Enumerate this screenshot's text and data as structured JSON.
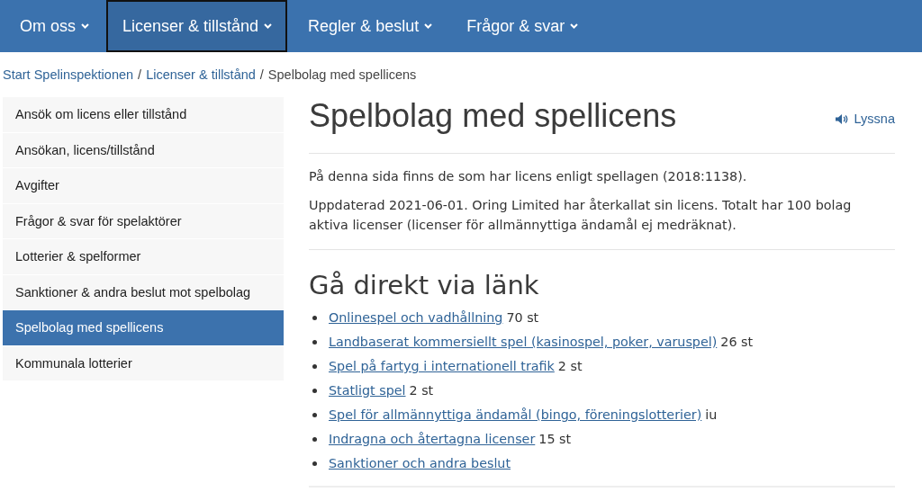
{
  "nav": [
    {
      "label": "Om oss",
      "selected": false
    },
    {
      "label": "Licenser & tillstånd",
      "selected": true
    },
    {
      "label": "Regler & beslut",
      "selected": false
    },
    {
      "label": "Frågor & svar",
      "selected": false
    }
  ],
  "breadcrumb": {
    "separator": "/",
    "links": [
      "Start Spelinspektionen",
      "Licenser & tillstånd"
    ],
    "current": "Spelbolag med spellicens"
  },
  "sidebar": {
    "items": [
      {
        "label": "Ansök om licens eller tillstånd",
        "selected": false
      },
      {
        "label": "Ansökan, licens/tillstånd",
        "selected": false
      },
      {
        "label": "Avgifter",
        "selected": false
      },
      {
        "label": "Frågor & svar för spelaktörer",
        "selected": false
      },
      {
        "label": "Lotterier & spelformer",
        "selected": false
      },
      {
        "label": "Sanktioner & andra beslut mot spelbolag",
        "selected": false
      },
      {
        "label": "Spelbolag med spellicens",
        "selected": true
      },
      {
        "label": "Kommunala lotterier",
        "selected": false
      }
    ]
  },
  "page": {
    "title": "Spelbolag med spellicens",
    "listen": "Lyssna",
    "paragraphs": [
      "På denna sida finns de som har licens enligt spellagen (2018:1138).",
      "Uppdaterad 2021-06-01. Oring Limited har återkallat sin licens. Totalt har 100 bolag aktiva licenser (licenser för allmännyttiga ändamål ej medräknat)."
    ],
    "links_heading": "Gå direkt via länk",
    "links": [
      {
        "label": "Onlinespel och vadhållning",
        "count": "70 st"
      },
      {
        "label": "Landbaserat kommersiellt spel (kasinospel, poker, varuspel)",
        "count": "26 st"
      },
      {
        "label": "Spel på fartyg i internationell trafik",
        "count": "2 st"
      },
      {
        "label": "Statligt spel",
        "count": "2 st"
      },
      {
        "label": "Spel för allmännyttiga ändamål (bingo, föreningslotterier)",
        "count": "iu"
      },
      {
        "label": "Indragna och återtagna licenser",
        "count": "15 st"
      },
      {
        "label": "Sanktioner och andra beslut"
      }
    ]
  }
}
